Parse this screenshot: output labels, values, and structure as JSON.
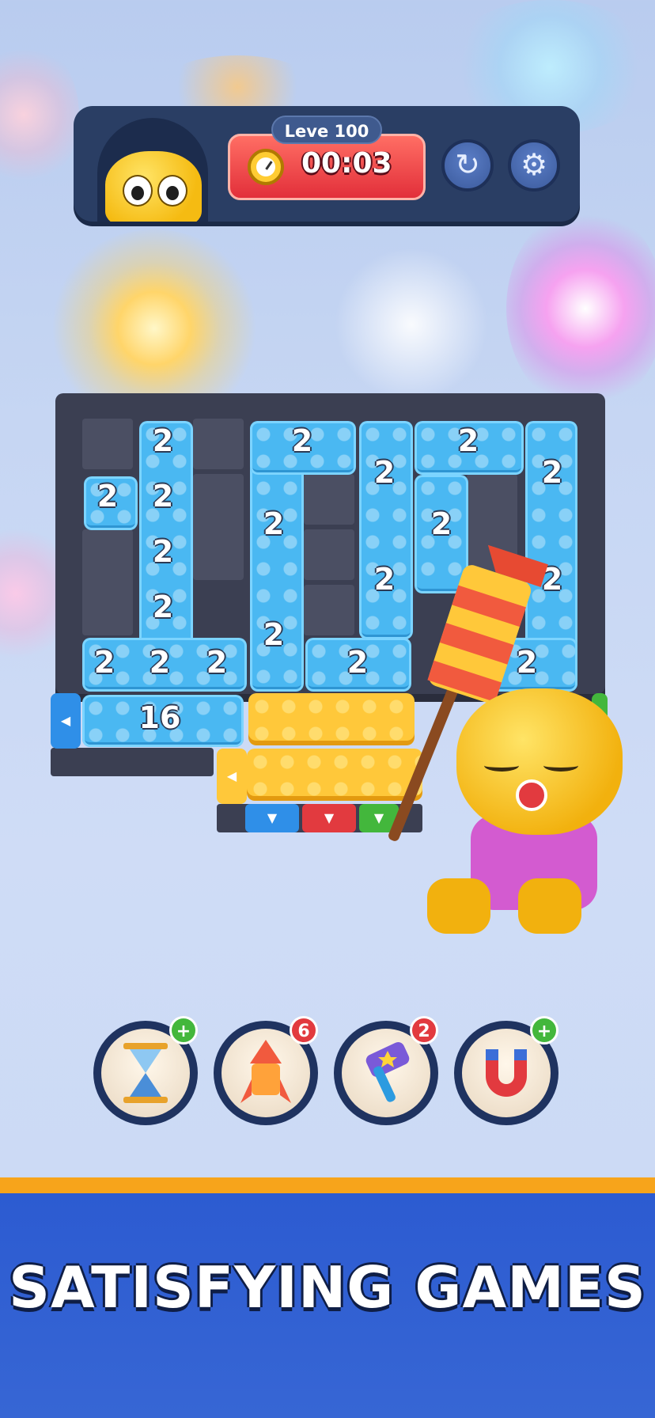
{
  "hud": {
    "level_label": "Leve 100",
    "timer": "00:03",
    "restart_icon": "restart-icon",
    "settings_icon": "gear-icon"
  },
  "board": {
    "tile_value": "2",
    "long_tile_value": "16"
  },
  "boosters": [
    {
      "name": "hourglass",
      "badge": "+"
    },
    {
      "name": "rocket",
      "badge": "6"
    },
    {
      "name": "hammer",
      "badge": "2"
    },
    {
      "name": "magnet",
      "badge": "+"
    }
  ],
  "banner": {
    "text": "SATISFYING GAMES"
  },
  "colors": {
    "banner_blue": "#2c5bd1",
    "accent_orange": "#f7a41b",
    "tile_blue": "#4ab8f2",
    "tile_yellow": "#ffc83a"
  }
}
